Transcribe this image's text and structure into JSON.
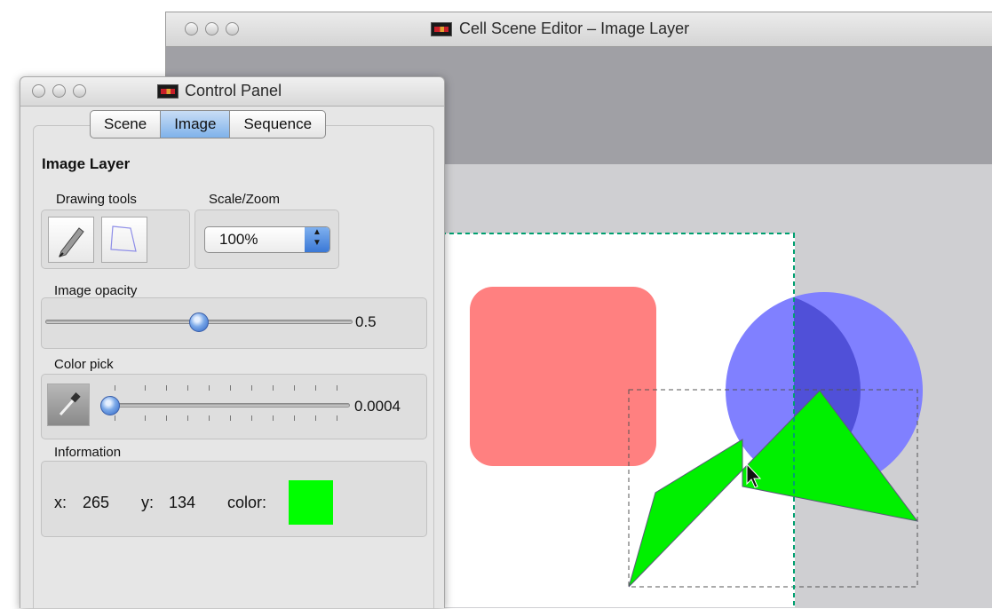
{
  "editor": {
    "title": "Cell Scene Editor – Image Layer"
  },
  "panel": {
    "title": "Control Panel",
    "tabs": [
      {
        "label": "Scene",
        "active": false
      },
      {
        "label": "Image",
        "active": true
      },
      {
        "label": "Sequence",
        "active": false
      }
    ],
    "section_title": "Image Layer",
    "drawing_tools": {
      "label": "Drawing tools",
      "tools": [
        "pencil-icon",
        "polygon-icon"
      ]
    },
    "scale_zoom": {
      "label": "Scale/Zoom",
      "value": "100%"
    },
    "image_opacity": {
      "label": "Image opacity",
      "value": "0.5",
      "level": 0.5
    },
    "color_pick": {
      "label": "Color pick",
      "value": "0.0004",
      "level": 0.0004
    },
    "information": {
      "label": "Information",
      "x_label": "x:",
      "x_value": "265",
      "y_label": "y:",
      "y_value": "134",
      "color_label": "color:",
      "color_value": "#00ff00"
    }
  },
  "canvas": {
    "shapes": [
      {
        "type": "rounded-rect",
        "color": "#ff8080"
      },
      {
        "type": "circle",
        "color": "#8080ff"
      },
      {
        "type": "polygon",
        "color": "#00ff00"
      }
    ]
  },
  "colors": {
    "accent": "#7fb2ea",
    "selection": "#00a070"
  }
}
